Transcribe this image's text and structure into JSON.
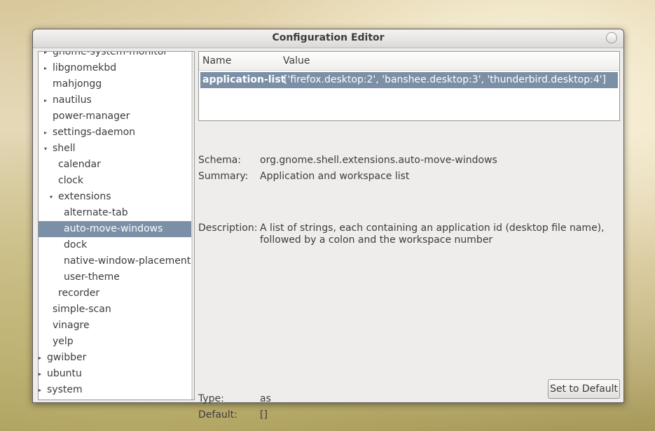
{
  "window": {
    "title": "Configuration Editor"
  },
  "tree": {
    "items": [
      {
        "label": "gnome-system-monitor",
        "expander": "▸"
      },
      {
        "label": "libgnomekbd",
        "expander": "▸"
      },
      {
        "label": "mahjongg",
        "expander": ""
      },
      {
        "label": "nautilus",
        "expander": "▸"
      },
      {
        "label": "power-manager",
        "expander": ""
      },
      {
        "label": "settings-daemon",
        "expander": "▸"
      },
      {
        "label": "shell",
        "expander": "▾"
      },
      {
        "label": "calendar",
        "expander": ""
      },
      {
        "label": "clock",
        "expander": ""
      },
      {
        "label": "extensions",
        "expander": "▾"
      },
      {
        "label": "alternate-tab",
        "expander": ""
      },
      {
        "label": "auto-move-windows",
        "expander": "",
        "selected": true
      },
      {
        "label": "dock",
        "expander": ""
      },
      {
        "label": "native-window-placement",
        "expander": ""
      },
      {
        "label": "user-theme",
        "expander": ""
      },
      {
        "label": "recorder",
        "expander": ""
      },
      {
        "label": "simple-scan",
        "expander": ""
      },
      {
        "label": "vinagre",
        "expander": ""
      },
      {
        "label": "yelp",
        "expander": ""
      },
      {
        "label": "gwibber",
        "expander": "▸"
      },
      {
        "label": "ubuntu",
        "expander": "▸"
      },
      {
        "label": "system",
        "expander": "▸"
      }
    ]
  },
  "keys": {
    "columns": {
      "name": "Name",
      "value": "Value"
    },
    "rows": [
      {
        "name": "application-list",
        "value": "['firefox.desktop:2', 'banshee.desktop:3', 'thunderbird.desktop:4']"
      }
    ]
  },
  "details": {
    "schema_label": "Schema:",
    "schema_value": "org.gnome.shell.extensions.auto-move-windows",
    "summary_label": "Summary:",
    "summary_value": "Application and workspace list",
    "description_label": "Description:",
    "description_line1": "A list of strings, each containing an application id (desktop file name),",
    "description_line2": "followed by a colon and the workspace number",
    "type_label": "Type:",
    "type_value": "as",
    "default_label": "Default:",
    "default_value": "[]"
  },
  "buttons": {
    "set_to_default": "Set to Default"
  }
}
